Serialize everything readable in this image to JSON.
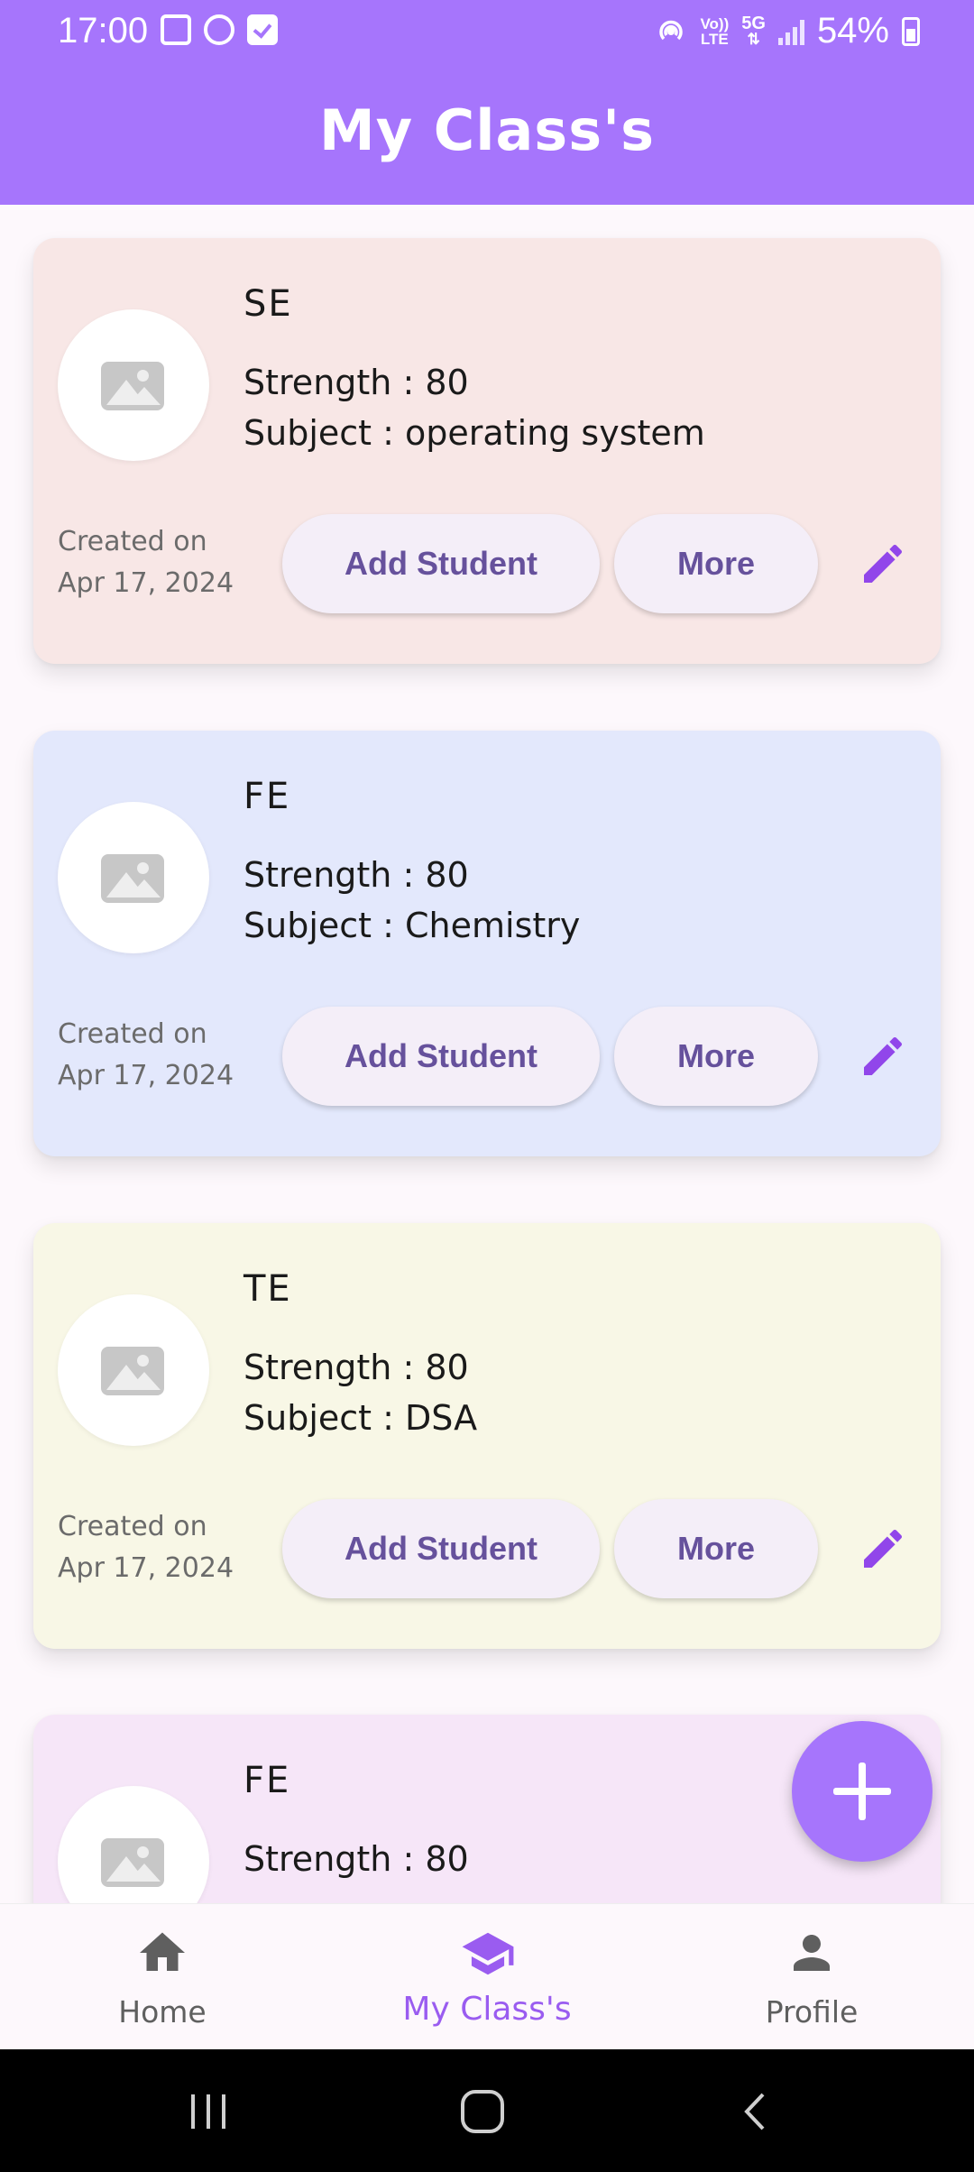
{
  "status_bar": {
    "time": "17:00",
    "battery": "54%",
    "network_top": "Vo))",
    "network_bottom": "LTE",
    "gen": "5G"
  },
  "app_bar": {
    "title": "My Class's"
  },
  "classes": [
    {
      "name": "SE",
      "strength": "Strength : 80",
      "subject": "Subject : operating system",
      "created_label": "Created on",
      "created_date": "Apr 17, 2024",
      "add_label": "Add Student",
      "more_label": "More",
      "color": "#f8e7e6"
    },
    {
      "name": "FE",
      "strength": "Strength : 80",
      "subject": "Subject : Chemistry",
      "created_label": "Created on",
      "created_date": "Apr 17, 2024",
      "add_label": "Add Student",
      "more_label": "More",
      "color": "#e3e8fc"
    },
    {
      "name": "TE",
      "strength": "Strength : 80",
      "subject": "Subject : DSA",
      "created_label": "Created on",
      "created_date": "Apr 17, 2024",
      "add_label": "Add Student",
      "more_label": "More",
      "color": "#f8f7e6"
    },
    {
      "name": "FE",
      "strength": "Strength : 80",
      "color": "#f6e6f8"
    }
  ],
  "bottom_nav": {
    "items": [
      {
        "label": "Home",
        "icon": "home-icon"
      },
      {
        "label": "My Class's",
        "icon": "graduation-cap-icon"
      },
      {
        "label": "Profile",
        "icon": "person-icon"
      }
    ]
  },
  "colors": {
    "accent": "#a675fc",
    "pill_text": "#66519c",
    "active_nav": "#9a5cf0"
  }
}
